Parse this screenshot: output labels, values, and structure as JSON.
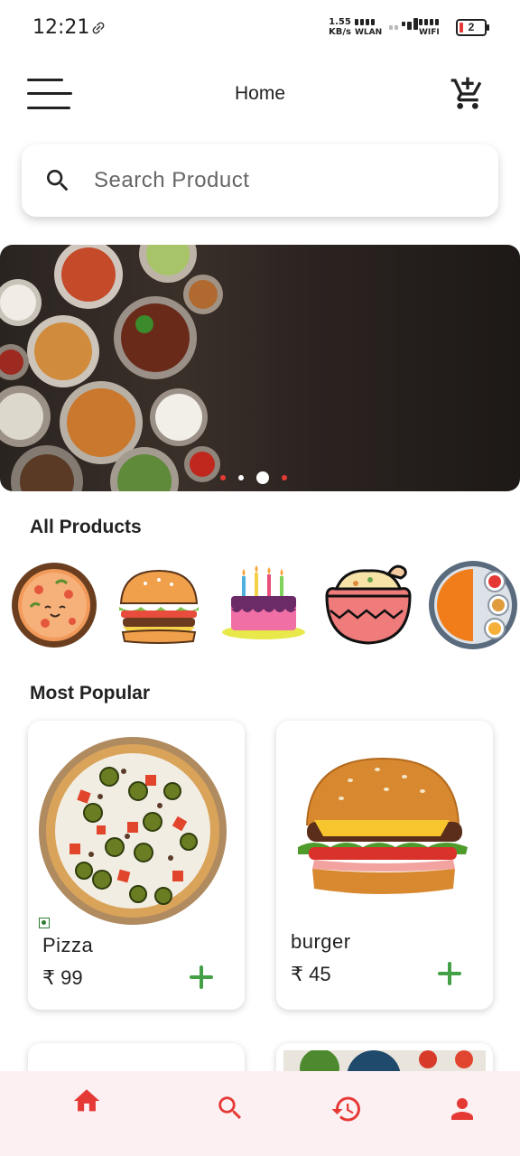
{
  "status_bar": {
    "time": "12:21",
    "net_speed_value": "1.55",
    "net_speed_unit": "KB/s",
    "wlan_label": "WLAN",
    "wifi_label": "WIFI",
    "battery_level": "2"
  },
  "app_bar": {
    "title": "Home"
  },
  "search": {
    "placeholder": "Search Product",
    "value": ""
  },
  "banner": {
    "page_count": 4,
    "active_index": 2
  },
  "sections": {
    "all_products_title": "All Products",
    "most_popular_title": "Most Popular"
  },
  "categories": [
    {
      "icon": "pizza-icon"
    },
    {
      "icon": "burger-icon"
    },
    {
      "icon": "cake-icon"
    },
    {
      "icon": "biryani-pot-icon"
    },
    {
      "icon": "thali-icon"
    }
  ],
  "products": [
    {
      "name": "Pizza",
      "price": "₹ 99",
      "veg": true
    },
    {
      "name": "burger",
      "price": "₹ 45",
      "veg": false
    }
  ],
  "bottom_nav": [
    {
      "icon": "home-icon",
      "active": true
    },
    {
      "icon": "search-icon",
      "active": false
    },
    {
      "icon": "history-icon",
      "active": false
    },
    {
      "icon": "person-icon",
      "active": false
    }
  ],
  "colors": {
    "accent": "#e53935",
    "add_green": "#43a047",
    "nav_background": "#fdf0f3"
  }
}
